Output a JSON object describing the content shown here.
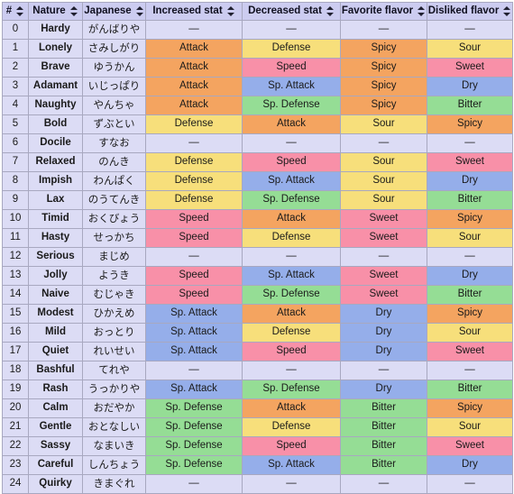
{
  "table": {
    "columns": [
      {
        "key": "num",
        "label": "#",
        "sortable": true
      },
      {
        "key": "nat",
        "label": "Nature",
        "sortable": true
      },
      {
        "key": "jp",
        "label": "Japanese",
        "sortable": true
      },
      {
        "key": "inc",
        "label": "Increased stat",
        "sortable": true
      },
      {
        "key": "dec",
        "label": "Decreased stat",
        "sortable": true
      },
      {
        "key": "fav",
        "label": "Favorite flavor",
        "sortable": true
      },
      {
        "key": "dis",
        "label": "Disliked flavor",
        "sortable": true
      }
    ],
    "sort_icon_name": "sort-updown-icon",
    "neutral_symbol": "—",
    "value_colors": {
      "Attack": "#f4a460",
      "Defense": "#f7df7b",
      "Speed": "#f890a8",
      "Sp. Attack": "#95aeea",
      "Sp. Defense": "#95dd95",
      "Spicy": "#f4a460",
      "Sour": "#f7df7b",
      "Sweet": "#f890a8",
      "Dry": "#95aeea",
      "Bitter": "#95dd95",
      "—": "#dcdcf5"
    },
    "header_bg": "#ccccf0",
    "row_bg": "#dcdcf5",
    "border_color": "#a8a8c0",
    "rows": [
      {
        "num": "0",
        "nat": "Hardy",
        "jp": "がんばりや",
        "inc": "—",
        "dec": "—",
        "fav": "—",
        "dis": "—"
      },
      {
        "num": "1",
        "nat": "Lonely",
        "jp": "さみしがり",
        "inc": "Attack",
        "dec": "Defense",
        "fav": "Spicy",
        "dis": "Sour"
      },
      {
        "num": "2",
        "nat": "Brave",
        "jp": "ゆうかん",
        "inc": "Attack",
        "dec": "Speed",
        "fav": "Spicy",
        "dis": "Sweet"
      },
      {
        "num": "3",
        "nat": "Adamant",
        "jp": "いじっぱり",
        "inc": "Attack",
        "dec": "Sp. Attack",
        "fav": "Spicy",
        "dis": "Dry"
      },
      {
        "num": "4",
        "nat": "Naughty",
        "jp": "やんちゃ",
        "inc": "Attack",
        "dec": "Sp. Defense",
        "fav": "Spicy",
        "dis": "Bitter"
      },
      {
        "num": "5",
        "nat": "Bold",
        "jp": "ずぶとい",
        "inc": "Defense",
        "dec": "Attack",
        "fav": "Sour",
        "dis": "Spicy"
      },
      {
        "num": "6",
        "nat": "Docile",
        "jp": "すなお",
        "inc": "—",
        "dec": "—",
        "fav": "—",
        "dis": "—"
      },
      {
        "num": "7",
        "nat": "Relaxed",
        "jp": "のんき",
        "inc": "Defense",
        "dec": "Speed",
        "fav": "Sour",
        "dis": "Sweet"
      },
      {
        "num": "8",
        "nat": "Impish",
        "jp": "わんぱく",
        "inc": "Defense",
        "dec": "Sp. Attack",
        "fav": "Sour",
        "dis": "Dry"
      },
      {
        "num": "9",
        "nat": "Lax",
        "jp": "のうてんき",
        "inc": "Defense",
        "dec": "Sp. Defense",
        "fav": "Sour",
        "dis": "Bitter"
      },
      {
        "num": "10",
        "nat": "Timid",
        "jp": "おくびょう",
        "inc": "Speed",
        "dec": "Attack",
        "fav": "Sweet",
        "dis": "Spicy"
      },
      {
        "num": "11",
        "nat": "Hasty",
        "jp": "せっかち",
        "inc": "Speed",
        "dec": "Defense",
        "fav": "Sweet",
        "dis": "Sour"
      },
      {
        "num": "12",
        "nat": "Serious",
        "jp": "まじめ",
        "inc": "—",
        "dec": "—",
        "fav": "—",
        "dis": "—"
      },
      {
        "num": "13",
        "nat": "Jolly",
        "jp": "ようき",
        "inc": "Speed",
        "dec": "Sp. Attack",
        "fav": "Sweet",
        "dis": "Dry"
      },
      {
        "num": "14",
        "nat": "Naive",
        "jp": "むじゃき",
        "inc": "Speed",
        "dec": "Sp. Defense",
        "fav": "Sweet",
        "dis": "Bitter"
      },
      {
        "num": "15",
        "nat": "Modest",
        "jp": "ひかえめ",
        "inc": "Sp. Attack",
        "dec": "Attack",
        "fav": "Dry",
        "dis": "Spicy"
      },
      {
        "num": "16",
        "nat": "Mild",
        "jp": "おっとり",
        "inc": "Sp. Attack",
        "dec": "Defense",
        "fav": "Dry",
        "dis": "Sour"
      },
      {
        "num": "17",
        "nat": "Quiet",
        "jp": "れいせい",
        "inc": "Sp. Attack",
        "dec": "Speed",
        "fav": "Dry",
        "dis": "Sweet"
      },
      {
        "num": "18",
        "nat": "Bashful",
        "jp": "てれや",
        "inc": "—",
        "dec": "—",
        "fav": "—",
        "dis": "—"
      },
      {
        "num": "19",
        "nat": "Rash",
        "jp": "うっかりや",
        "inc": "Sp. Attack",
        "dec": "Sp. Defense",
        "fav": "Dry",
        "dis": "Bitter"
      },
      {
        "num": "20",
        "nat": "Calm",
        "jp": "おだやか",
        "inc": "Sp. Defense",
        "dec": "Attack",
        "fav": "Bitter",
        "dis": "Spicy"
      },
      {
        "num": "21",
        "nat": "Gentle",
        "jp": "おとなしい",
        "inc": "Sp. Defense",
        "dec": "Defense",
        "fav": "Bitter",
        "dis": "Sour"
      },
      {
        "num": "22",
        "nat": "Sassy",
        "jp": "なまいき",
        "inc": "Sp. Defense",
        "dec": "Speed",
        "fav": "Bitter",
        "dis": "Sweet"
      },
      {
        "num": "23",
        "nat": "Careful",
        "jp": "しんちょう",
        "inc": "Sp. Defense",
        "dec": "Sp. Attack",
        "fav": "Bitter",
        "dis": "Dry"
      },
      {
        "num": "24",
        "nat": "Quirky",
        "jp": "きまぐれ",
        "inc": "—",
        "dec": "—",
        "fav": "—",
        "dis": "—"
      }
    ]
  }
}
